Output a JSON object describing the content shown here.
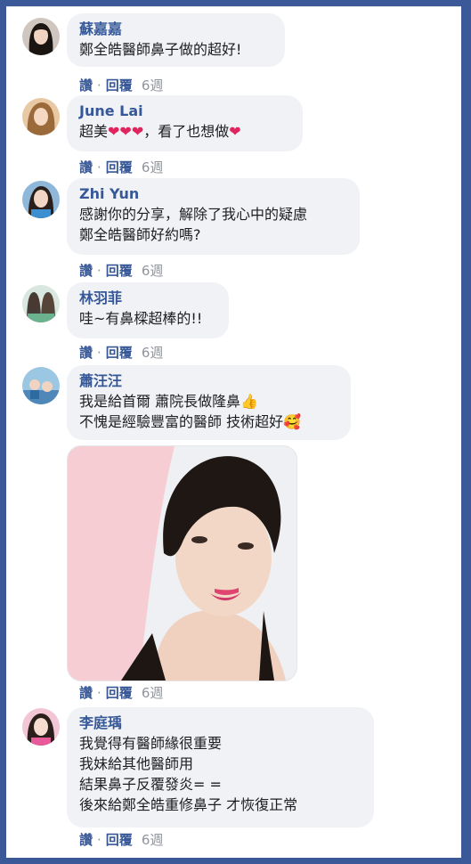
{
  "actions": {
    "like": "讚",
    "reply": "回覆",
    "dot": "·"
  },
  "comments": [
    {
      "name": "蘇嘉嘉",
      "lines": [
        "鄭全皓醫師鼻子做的超好!"
      ],
      "time": "6週"
    },
    {
      "name": "June Lai",
      "line_prefix": "超美",
      "hearts": "❤❤❤",
      "line_suffix": "，看了也想做",
      "heart_end": "❤",
      "time": "6週"
    },
    {
      "name": "Zhi Yun",
      "lines": [
        "感謝你的分享，解除了我心中的疑慮",
        "鄭全皓醫師好約嗎?"
      ],
      "time": "6週"
    },
    {
      "name": "林羽菲",
      "lines": [
        "哇~有鼻樑超棒的!!"
      ],
      "time": "6週"
    },
    {
      "name": "蕭汪汪",
      "lines": [
        "我是給首爾 蕭院長做隆鼻",
        "不愧是經驗豐富的醫師 技術超好"
      ],
      "emoji1": "👍",
      "emoji2": "🥰",
      "time": "6週"
    },
    {
      "name": "李庭瑀",
      "lines": [
        "我覺得有醫師緣很重要",
        "我妹給其他醫師用",
        "結果鼻子反覆發炎= =",
        "後來給鄭全皓重修鼻子 才恢復正常"
      ],
      "time": "6週"
    }
  ],
  "colors": {
    "frame": "#3b5998",
    "name": "#365899",
    "bubble": "#f0f2f5",
    "heart": "#e0245e"
  }
}
